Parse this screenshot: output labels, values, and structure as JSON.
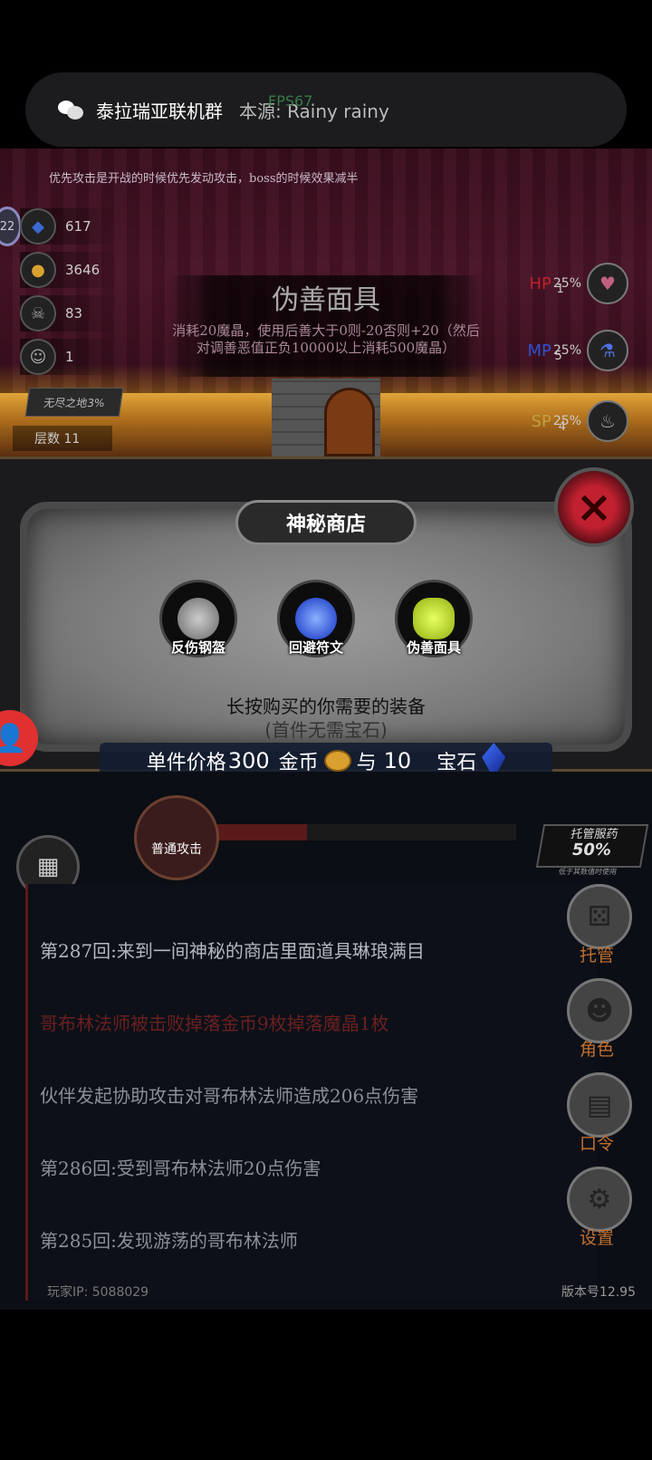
{
  "notification": {
    "group": "泰拉瑞亚联机群",
    "source": "本源: Rainy rainy",
    "overlay": "FPS67"
  },
  "battle": {
    "tip": "优先攻击是开战的时候优先发动攻击，boss的时候效果减半",
    "level_badge": "22",
    "resources": [
      {
        "icon": "gem-icon",
        "label": "宝石",
        "value": "617"
      },
      {
        "icon": "coin-icon",
        "label": "金币",
        "value": "3646"
      },
      {
        "icon": "skull-icon",
        "label": "魔晶",
        "value": "83"
      },
      {
        "icon": "mask-icon",
        "label": "善恶",
        "value": "1"
      }
    ],
    "endless": "无尽之地3%",
    "floor": "层数 11",
    "item": {
      "title": "伪善面具",
      "desc": "消耗20魔晶，使用后善大于0则-20否则+20（然后对调善恶值正负10000以上消耗500魔晶）"
    },
    "potions": [
      {
        "label": "HP",
        "pct": "25%",
        "count": "1",
        "color": "#c02030"
      },
      {
        "label": "MP",
        "pct": "25%",
        "count": "5",
        "color": "#3050d0"
      },
      {
        "label": "SP",
        "pct": "25%",
        "count": "4",
        "color": "#c0a040"
      }
    ]
  },
  "shop": {
    "title": "神秘商店",
    "items": [
      {
        "name": "反伤钢盔",
        "icon": "helmet-icon",
        "color": "#999"
      },
      {
        "name": "回避符文",
        "icon": "rune-icon",
        "color": "#2040d0"
      },
      {
        "name": "伪善面具",
        "icon": "mask-icon",
        "color": "#b8d820"
      }
    ],
    "hint1": "长按购买的你需要的装备",
    "hint2": "(首件无需宝石)",
    "price_label": "单件价格",
    "price_gold": "300",
    "gold_label": "金币",
    "and": "与",
    "price_gems": "10",
    "gem_label": "宝石"
  },
  "controls": {
    "attack": "普通攻击",
    "shop": "商铺",
    "auto_pot_title": "托管服药",
    "auto_pot_pct": "50%",
    "auto_pot_note": "低于其数值时使用"
  },
  "log": [
    {
      "text": "第287回:来到一间神秘的商店里面道具琳琅满目",
      "style": "bright"
    },
    {
      "text": "哥布林法师被击败掉落金币9枚掉落魔晶1枚",
      "style": "red"
    },
    {
      "text": "伙伴发起协助攻击对哥布林法师造成206点伤害",
      "style": "normal"
    },
    {
      "text": "第286回:受到哥布林法师20点伤害",
      "style": "normal"
    },
    {
      "text": "第285回:发现游荡的哥布林法师",
      "style": "normal"
    }
  ],
  "side_menu": [
    {
      "label": "托管",
      "icon": "dice-icon"
    },
    {
      "label": "角色",
      "icon": "hooded-figure-icon"
    },
    {
      "label": "口令",
      "icon": "book-icon"
    },
    {
      "label": "设置",
      "icon": "gear-icon"
    }
  ],
  "footer": {
    "ip": "玩家IP: 5088029",
    "version": "版本号12.95"
  }
}
